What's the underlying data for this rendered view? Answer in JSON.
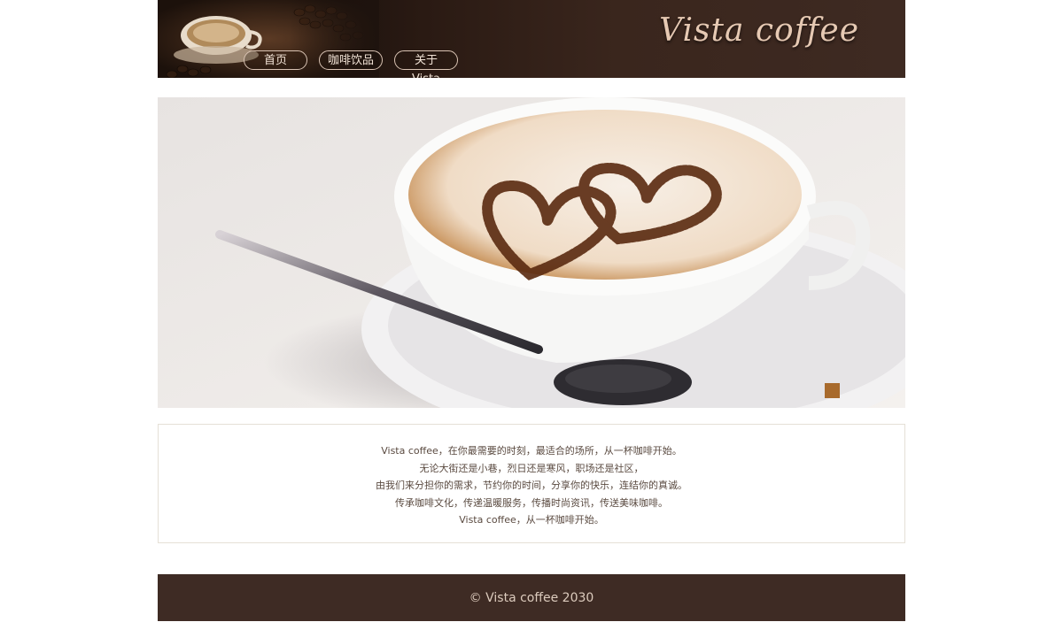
{
  "header": {
    "brand": "Vista coffee",
    "nav": [
      {
        "label": "首页"
      },
      {
        "label": "咖啡饮品"
      },
      {
        "label": "关于Vista"
      }
    ]
  },
  "hero": {
    "slide_count": 1,
    "active_slide": 1,
    "indicator_color": "#a86a2c"
  },
  "intro": {
    "lines": [
      "Vista coffee，在你最需要的时刻，最适合的场所，从一杯咖啡开始。",
      "无论大街还是小巷，烈日还是寒风，职场还是社区，",
      "由我们来分担你的需求，节约你的时间，分享你的快乐，连结你的真诚。",
      "传承咖啡文化，传递温暖服务，传播时尚资讯，传送美味咖啡。",
      "Vista coffee，从一杯咖啡开始。"
    ]
  },
  "footer": {
    "copyright": "© Vista coffee 2030"
  },
  "colors": {
    "header_bg": "#3e2a22",
    "footer_bg": "#3e2b24",
    "brand_text": "#e6c9b3",
    "accent": "#a86a2c"
  }
}
